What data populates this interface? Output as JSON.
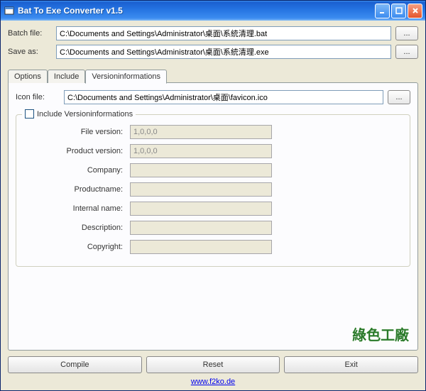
{
  "window": {
    "title": "Bat To Exe Converter v1.5"
  },
  "files": {
    "batch_label": "Batch file:",
    "batch_value": "C:\\Documents and Settings\\Administrator\\桌面\\系統清理.bat",
    "save_label": "Save as:",
    "save_value": "C:\\Documents and Settings\\Administrator\\桌面\\系統清理.exe",
    "browse": "..."
  },
  "tabs": {
    "options": "Options",
    "include": "Include",
    "versioninfo": "Versioninformations"
  },
  "icon": {
    "label": "Icon file:",
    "value": "C:\\Documents and Settings\\Administrator\\桌面\\favicon.ico",
    "browse": "..."
  },
  "versiongroup": {
    "checkbox_label": "Include Versioninformations",
    "fields": {
      "file_version_label": "File version:",
      "file_version_value": "1,0,0,0",
      "product_version_label": "Product version:",
      "product_version_value": "1,0,0,0",
      "company_label": "Company:",
      "company_value": "",
      "productname_label": "Productname:",
      "productname_value": "",
      "internal_name_label": "Internal name:",
      "internal_name_value": "",
      "description_label": "Description:",
      "description_value": "",
      "copyright_label": "Copyright:",
      "copyright_value": ""
    }
  },
  "watermark": "綠色工廠",
  "buttons": {
    "compile": "Compile",
    "reset": "Reset",
    "exit": "Exit"
  },
  "footer": {
    "link": "www.f2ko.de"
  }
}
